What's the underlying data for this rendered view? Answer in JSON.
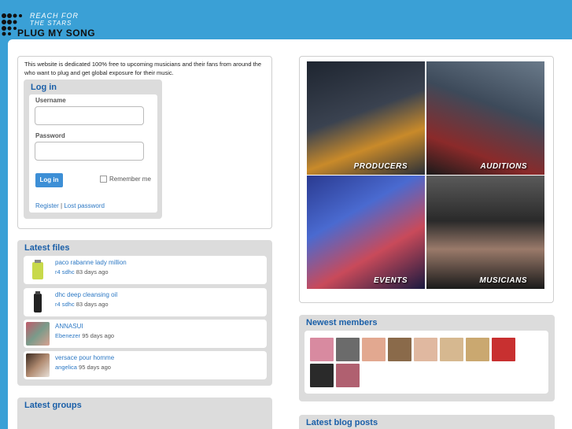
{
  "header": {
    "tagline_line1": "REACH FOR",
    "tagline_line2": "THE STARS",
    "brand": "PLUG MY SONG"
  },
  "intro": {
    "text": "This website is dedicated 100% free to upcoming musicians and their fans from around the who want to plug and get global exposure for their music."
  },
  "login": {
    "title": "Log in",
    "username_label": "Username",
    "username_value": "",
    "password_label": "Password",
    "password_value": "",
    "submit_label": "Log in",
    "remember_label": "Remember me",
    "register_link": "Register",
    "separator": "|",
    "lost_password_link": "Lost password"
  },
  "latest_files": {
    "title": "Latest files",
    "items": [
      {
        "title": "paco rabanne lady million",
        "user": "r4 sdhc",
        "age": "83 days ago",
        "thumb_color": "#c8d94a"
      },
      {
        "title": "dhc deep cleansing oil",
        "user": "r4 sdhc",
        "age": "83 days ago",
        "thumb_color": "#222222"
      },
      {
        "title": "ANNASUI",
        "user": "Ebenezer",
        "age": "95 days ago",
        "thumb_color": "#7a9b8a"
      },
      {
        "title": "versace pour homme",
        "user": "angelica",
        "age": "95 days ago",
        "thumb_color": "#5a4a3a"
      }
    ]
  },
  "latest_groups": {
    "title": "Latest groups"
  },
  "feature_tiles": [
    {
      "label": "PRODUCERS",
      "color_a": "#2a2f38",
      "color_b": "#c98a2a"
    },
    {
      "label": "AUDITIONS",
      "color_a": "#3d4a5a",
      "color_b": "#8b2a2a"
    },
    {
      "label": "EVENTS",
      "color_a": "#3a55a8",
      "color_b": "#c94a5a"
    },
    {
      "label": "MUSICIANS",
      "color_a": "#2a2a2a",
      "color_b": "#9a7a6a"
    }
  ],
  "newest_members": {
    "title": "Newest members",
    "avatars": [
      {
        "name": "member-1",
        "color": "#d88aa0"
      },
      {
        "name": "member-2",
        "color": "#6b6b6b"
      },
      {
        "name": "member-3",
        "color": "#e2a890"
      },
      {
        "name": "member-4",
        "color": "#8a6a4a"
      },
      {
        "name": "member-5",
        "color": "#e0b8a0"
      },
      {
        "name": "member-6",
        "color": "#d6b890"
      },
      {
        "name": "member-7",
        "color": "#caa870"
      },
      {
        "name": "member-8",
        "color": "#c83030"
      },
      {
        "name": "member-9",
        "color": "#2a2a2a"
      },
      {
        "name": "member-10",
        "color": "#b06070"
      }
    ]
  },
  "latest_blog_posts": {
    "title": "Latest blog posts"
  },
  "colors": {
    "header_bg": "#3aa0d6",
    "accent_blue": "#1a5fa8",
    "link_blue": "#2c78c4",
    "button_blue": "#3d8fd6"
  }
}
